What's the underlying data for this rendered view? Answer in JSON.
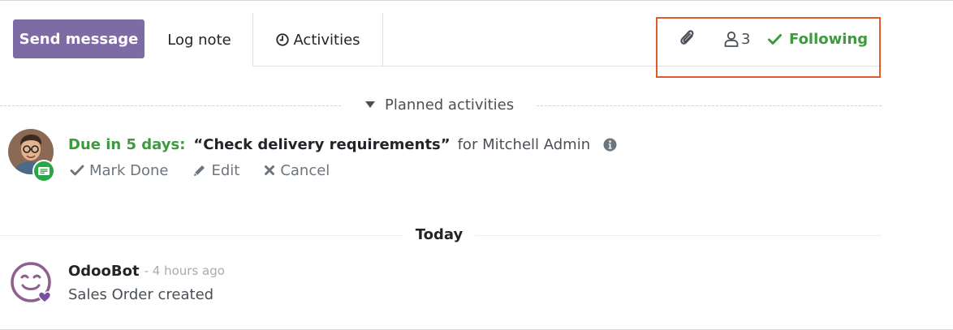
{
  "composer": {
    "send_message": "Send message",
    "log_note": "Log note",
    "activities": "Activities"
  },
  "topbar_right": {
    "attachment_icon": "paperclip-icon",
    "followers_count": "3",
    "following_label": "Following"
  },
  "planned": {
    "title": "Planned activities"
  },
  "activity": {
    "due_label": "Due in 5 days:",
    "summary": "“Check delivery requirements”",
    "assignee_text": "for Mitchell Admin",
    "actions": {
      "mark_done": "Mark Done",
      "edit": "Edit",
      "cancel": "Cancel"
    }
  },
  "day_separator": "Today",
  "message": {
    "author": "OdooBot",
    "date": "- 4 hours ago",
    "body": "Sales Order created"
  },
  "colors": {
    "primary": "#7c6ba5",
    "success": "#3d9a3d",
    "highlight_border": "#e05a2b"
  }
}
